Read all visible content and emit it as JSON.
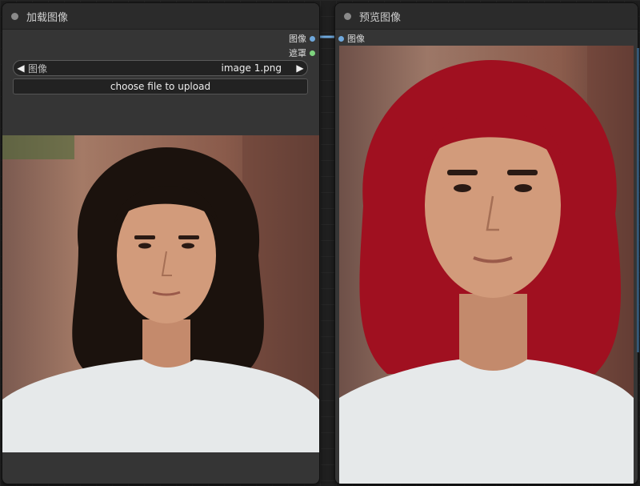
{
  "load_node": {
    "title": "加载图像",
    "outputs": [
      {
        "label": "图像",
        "color": "#6fa8dc"
      },
      {
        "label": "遮罩",
        "color": "#7ed37e"
      }
    ],
    "image_widget": {
      "label": "图像",
      "value": "image 1.png"
    },
    "upload_label": "choose file to upload"
  },
  "preview_node": {
    "title": "预览图像",
    "inputs": [
      {
        "label": "图像",
        "color": "#6fa8dc"
      }
    ]
  },
  "photos": {
    "source_hair_color": "#1b120d",
    "result_hair_color": "#a01020"
  }
}
